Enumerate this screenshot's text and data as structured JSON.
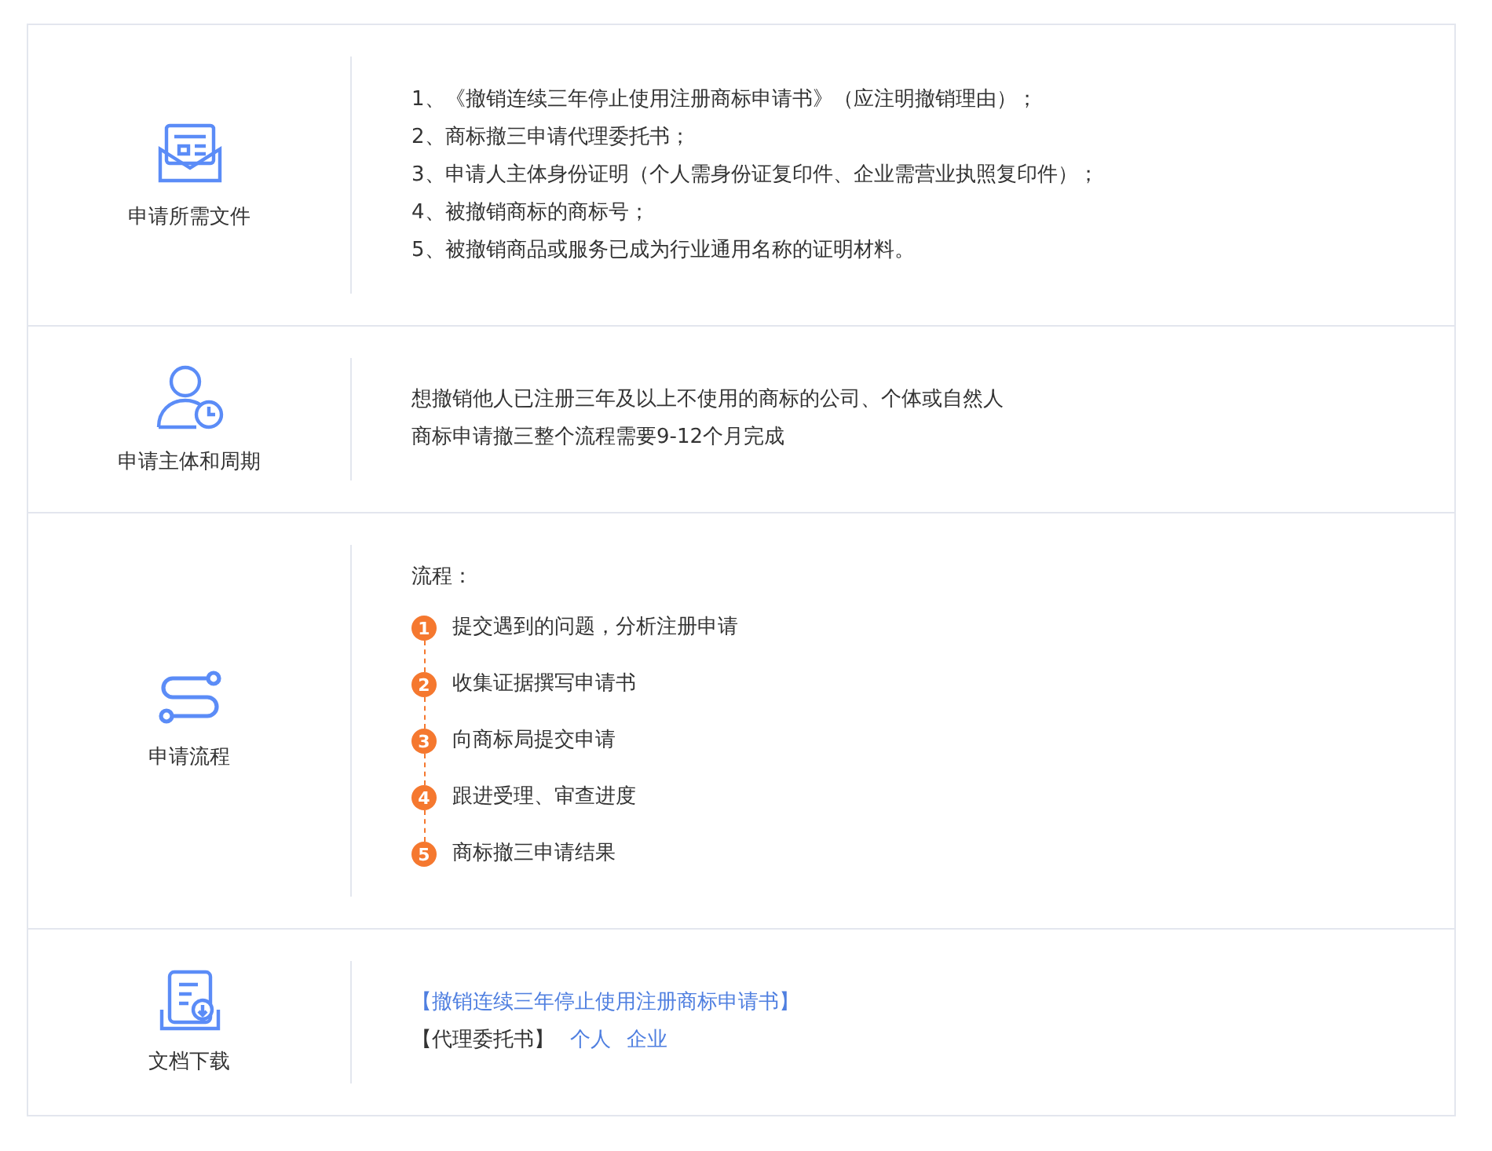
{
  "sections": [
    {
      "kind": "list",
      "title": "申请所需文件",
      "lines": [
        "1、《撤销连续三年停止使用注册商标申请书》（应注明撤销理由）；",
        "2、商标撤三申请代理委托书；",
        "3、申请人主体身份证明（个人需身份证复印件、企业需营业执照复印件）；",
        "4、被撤销商标的商标号；",
        "5、被撤销商品或服务已成为行业通用名称的证明材料。"
      ]
    },
    {
      "kind": "lines",
      "title": "申请主体和周期",
      "lines": [
        "想撤销他人已注册三年及以上不使用的商标的公司、个体或自然人",
        "商标申请撤三整个流程需要9-12个月完成"
      ]
    },
    {
      "kind": "steps",
      "title": "申请流程",
      "heading": "流程：",
      "steps": [
        {
          "number": "1",
          "text": "提交遇到的问题，分析注册申请"
        },
        {
          "number": "2",
          "text": "收集证据撰写申请书"
        },
        {
          "number": "3",
          "text": "向商标局提交申请"
        },
        {
          "number": "4",
          "text": "跟进受理、审查进度"
        },
        {
          "number": "5",
          "text": "商标撤三申请结果"
        }
      ]
    },
    {
      "kind": "downloads",
      "title": "文档下载",
      "downloads": [
        {
          "links": [
            "【撤销连续三年停止使用注册商标申请书】"
          ]
        },
        {
          "label": "【代理委托书】",
          "links": [
            "个人",
            "企业"
          ]
        }
      ]
    }
  ]
}
